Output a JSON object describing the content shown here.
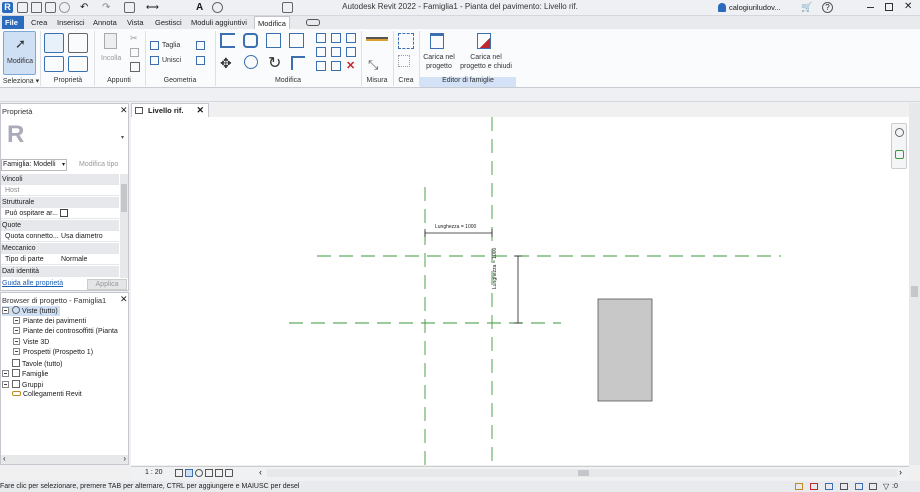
{
  "window": {
    "title": "Autodesk Revit 2022 - Famiglia1 - Pianta del pavimento: Livello rif.",
    "user": "calogiuriludov...",
    "help": "?"
  },
  "menu": {
    "tabs": [
      "File",
      "Crea",
      "Inserisci",
      "Annota",
      "Vista",
      "Gestisci",
      "Moduli aggiuntivi",
      "Modifica"
    ],
    "active": "Modifica"
  },
  "ribbon": {
    "modify_label": "Modifica",
    "incolla_label": "Incolla",
    "taglia_label": "Taglia",
    "unisci_label": "Unisci",
    "carica_progetto_label": "Carica nel progetto",
    "carica_chiudi_label": "Carica nel progetto e chiudi",
    "groups": {
      "seleziona": "Seleziona ▾",
      "proprieta": "Proprietà",
      "appunti": "Appunti",
      "geometria": "Geometria",
      "modifica": "Modifica",
      "misura": "Misura",
      "crea": "Crea",
      "editor": "Editor di famiglie"
    }
  },
  "properties": {
    "title": "Proprietà",
    "family_type": "Famiglia: Modelli",
    "modify_type": "Modifica tipo",
    "rows": [
      {
        "category": "Vincoli"
      },
      {
        "label": "Host",
        "value": ""
      },
      {
        "category": "Strutturale"
      },
      {
        "label": "Può ospitare ar...",
        "value": ""
      },
      {
        "category": "Quote"
      },
      {
        "label": "Quota connetto...",
        "value": "Usa diametro"
      },
      {
        "category": "Meccanico"
      },
      {
        "label": "Tipo di parte",
        "value": "Normale"
      },
      {
        "category": "Dati identità"
      }
    ],
    "help_link": "Guida alle proprietà",
    "apply": "Applica"
  },
  "browser": {
    "title": "Browser di progetto - Famiglia1",
    "items": [
      {
        "label": "Viste (tutto)",
        "level": 0
      },
      {
        "label": "Piante dei pavimenti",
        "level": 1
      },
      {
        "label": "Piante dei controsoffitti (Pianta",
        "level": 1
      },
      {
        "label": "Viste 3D",
        "level": 1
      },
      {
        "label": "Prospetti (Prospetto 1)",
        "level": 1
      },
      {
        "label": "Tavole (tutto)",
        "level": 0
      },
      {
        "label": "Famiglie",
        "level": 0
      },
      {
        "label": "Gruppi",
        "level": 0
      },
      {
        "label": "Collegamenti Revit",
        "level": 0
      }
    ]
  },
  "view": {
    "tab": "Livello rif.",
    "scale": "1 : 20",
    "dim_horizontal": "Lunghezza = 1000",
    "dim_vertical": "Lunghezza = 1000"
  },
  "status": {
    "text": "Fare clic per selezionare, premere TAB per alternare, CTRL per aggiungere e MAIUSC per desel",
    "filter_count": ":0"
  },
  "colors": {
    "accent": "#2a6bbd",
    "ref_plane": "#3a9a3a",
    "editor_tab": "#d3e2f7"
  }
}
